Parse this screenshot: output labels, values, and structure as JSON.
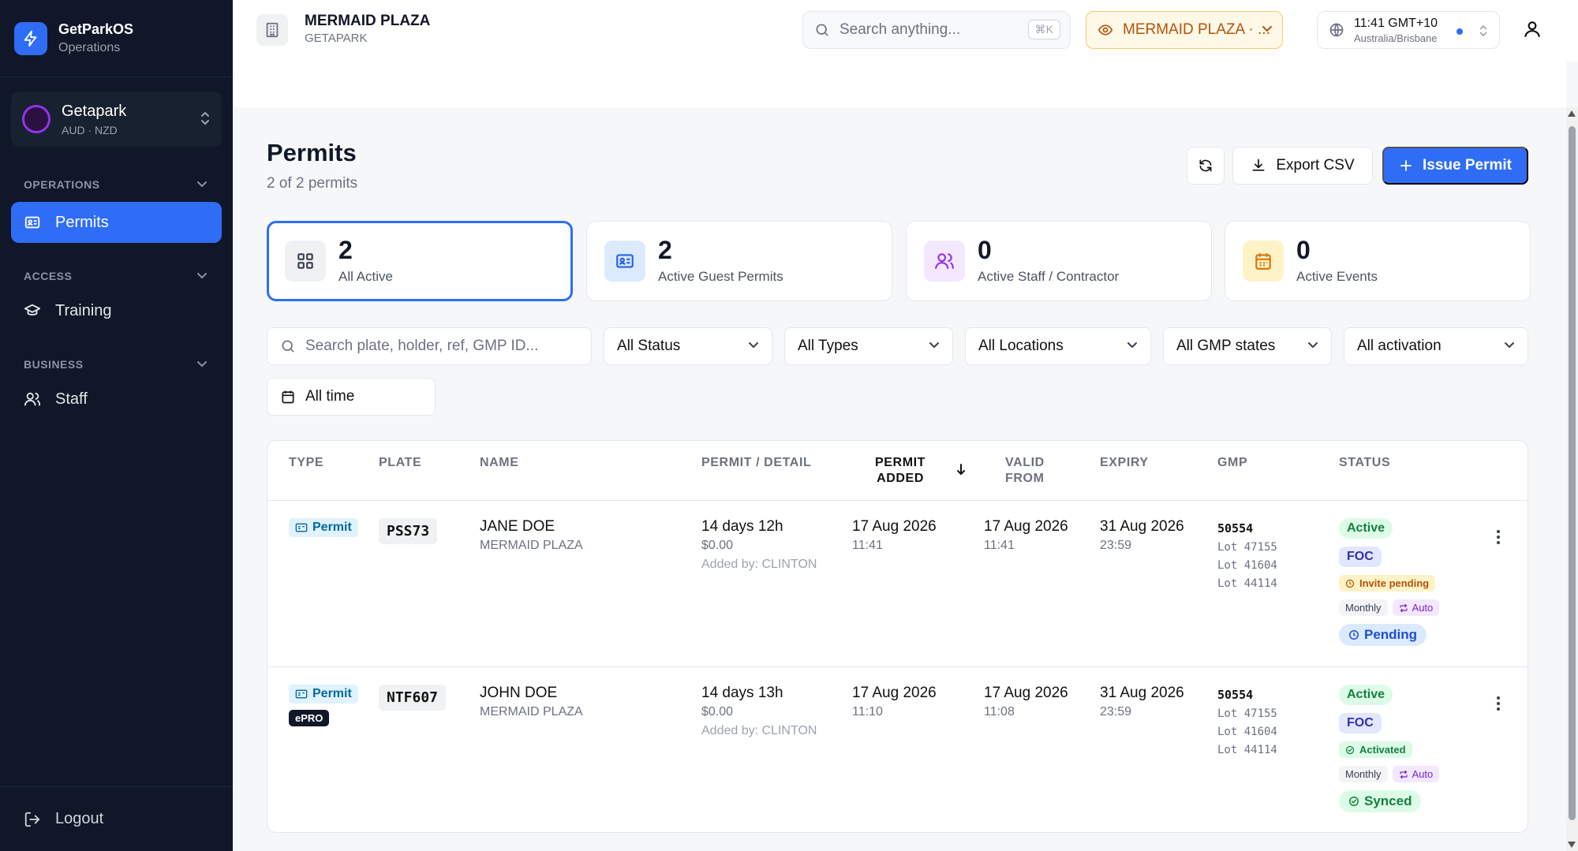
{
  "app": {
    "name": "GetParkOS",
    "subtitle": "Operations"
  },
  "org": {
    "name": "Getapark",
    "currencies": "AUD · NZD"
  },
  "sidebar": {
    "sections": [
      {
        "label": "OPERATIONS",
        "items": [
          {
            "label": "Permits",
            "icon": "id-card-icon",
            "active": true
          }
        ]
      },
      {
        "label": "ACCESS",
        "items": [
          {
            "label": "Training",
            "icon": "graduation-cap-icon"
          }
        ]
      },
      {
        "label": "BUSINESS",
        "items": [
          {
            "label": "Staff",
            "icon": "users-icon"
          }
        ]
      }
    ],
    "logout_label": "Logout"
  },
  "header": {
    "site_title": "MERMAID PLAZA",
    "site_sub": "GETAPARK",
    "search_placeholder": "Search anything...",
    "search_shortcut": "⌘K",
    "site_select": "MERMAID PLAZA · ...",
    "time": "11:41 GMT+10",
    "timezone": "Australia/Brisbane"
  },
  "page": {
    "title": "Permits",
    "subtitle": "2 of 2 permits",
    "export_label": "Export CSV",
    "issue_label": "Issue Permit"
  },
  "stats": [
    {
      "value": "2",
      "label": "All Active",
      "color": "#374151",
      "bg": "#f0f1f3"
    },
    {
      "value": "2",
      "label": "Active Guest Permits",
      "color": "#2563eb",
      "bg": "#dbeafe"
    },
    {
      "value": "0",
      "label": "Active Staff / Contractor",
      "color": "#9333ea",
      "bg": "#f3e8ff"
    },
    {
      "value": "0",
      "label": "Active Events",
      "color": "#d97706",
      "bg": "#fef3c7"
    }
  ],
  "filters": {
    "search_placeholder": "Search plate, holder, ref, GMP ID...",
    "status": "All Status",
    "types": "All Types",
    "locations": "All Locations",
    "gmp_states": "All GMP states",
    "activation": "All activation",
    "time": "All time"
  },
  "table": {
    "columns": {
      "type": "TYPE",
      "plate": "PLATE",
      "name": "NAME",
      "detail": "PERMIT / DETAIL",
      "added_1": "PERMIT",
      "added_2": "ADDED",
      "valid_1": "VALID",
      "valid_2": "FROM",
      "expiry": "EXPIRY",
      "gmp": "GMP",
      "status": "STATUS"
    },
    "rows": [
      {
        "type": "Permit",
        "plate": "PSS73",
        "name": "JANE DOE",
        "location": "MERMAID PLAZA",
        "duration": "14 days 12h",
        "price": "$0.00",
        "added_by": "Added by: CLINTON",
        "added_date": "17 Aug 2026",
        "added_time": "11:41",
        "valid_date": "17 Aug 2026",
        "valid_time": "11:41",
        "expiry_date": "31 Aug 2026",
        "expiry_time": "23:59",
        "gmp_id": "50554",
        "lots": [
          "Lot 47155",
          "Lot 41604",
          "Lot 44114"
        ],
        "status": "Active",
        "foc": "FOC",
        "activation": "Invite pending",
        "billing": "Monthly",
        "renew": "Auto",
        "sync": "Pending"
      },
      {
        "type": "Permit",
        "badge": "ePRO",
        "plate": "NTF607",
        "name": "JOHN DOE",
        "location": "MERMAID PLAZA",
        "duration": "14 days 13h",
        "price": "$0.00",
        "added_by": "Added by: CLINTON",
        "added_date": "17 Aug 2026",
        "added_time": "11:10",
        "valid_date": "17 Aug 2026",
        "valid_time": "11:08",
        "expiry_date": "31 Aug 2026",
        "expiry_time": "23:59",
        "gmp_id": "50554",
        "lots": [
          "Lot 47155",
          "Lot 41604",
          "Lot 44114"
        ],
        "status": "Active",
        "foc": "FOC",
        "activation": "Activated",
        "billing": "Monthly",
        "renew": "Auto",
        "sync": "Synced"
      }
    ]
  }
}
